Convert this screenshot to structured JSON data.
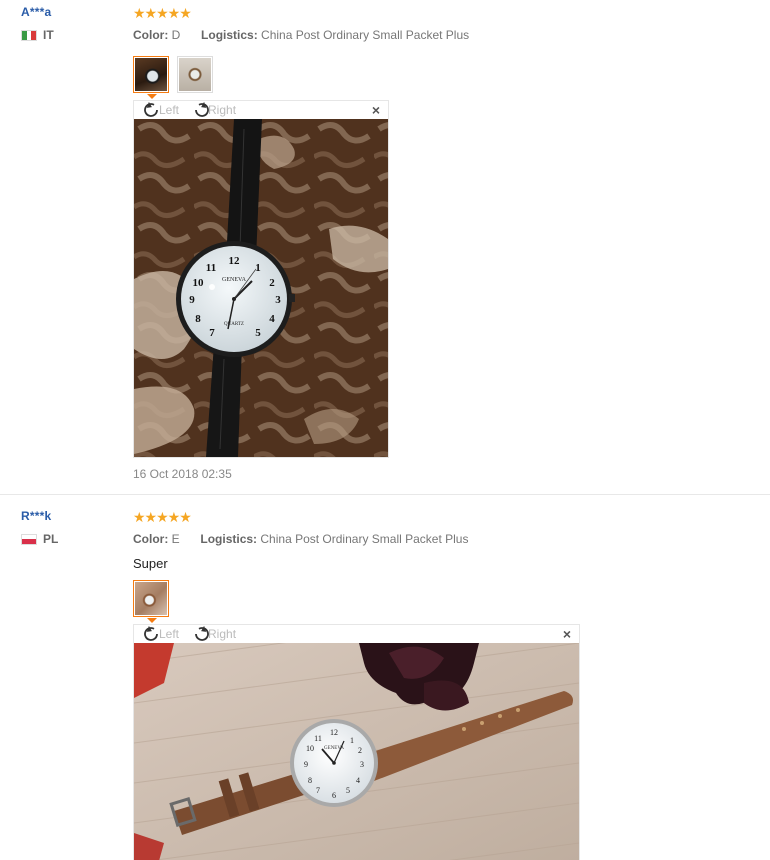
{
  "reviews": [
    {
      "user": "A***a",
      "country": "IT",
      "stars": "★★★★★",
      "color_label": "Color:",
      "color_value": "D",
      "logistics_label": "Logistics:",
      "logistics_value": "China Post Ordinary Small Packet Plus",
      "text": "",
      "viewer": {
        "left_label": "Left",
        "right_label": "Right",
        "close": "×"
      },
      "watch_brand": "GENEVA",
      "watch_sub": "QUARTZ",
      "date": "16 Oct 2018 02:35"
    },
    {
      "user": "R***k",
      "country": "PL",
      "stars": "★★★★★",
      "color_label": "Color:",
      "color_value": "E",
      "logistics_label": "Logistics:",
      "logistics_value": "China Post Ordinary Small Packet Plus",
      "text": "Super",
      "viewer": {
        "left_label": "Left",
        "right_label": "Right",
        "close": "×"
      },
      "watch_brand": "GENEVA"
    }
  ],
  "colors": {
    "username": "#2a5ca8",
    "stars": "#f5a623",
    "thumb_active_border": "#f57c12"
  }
}
